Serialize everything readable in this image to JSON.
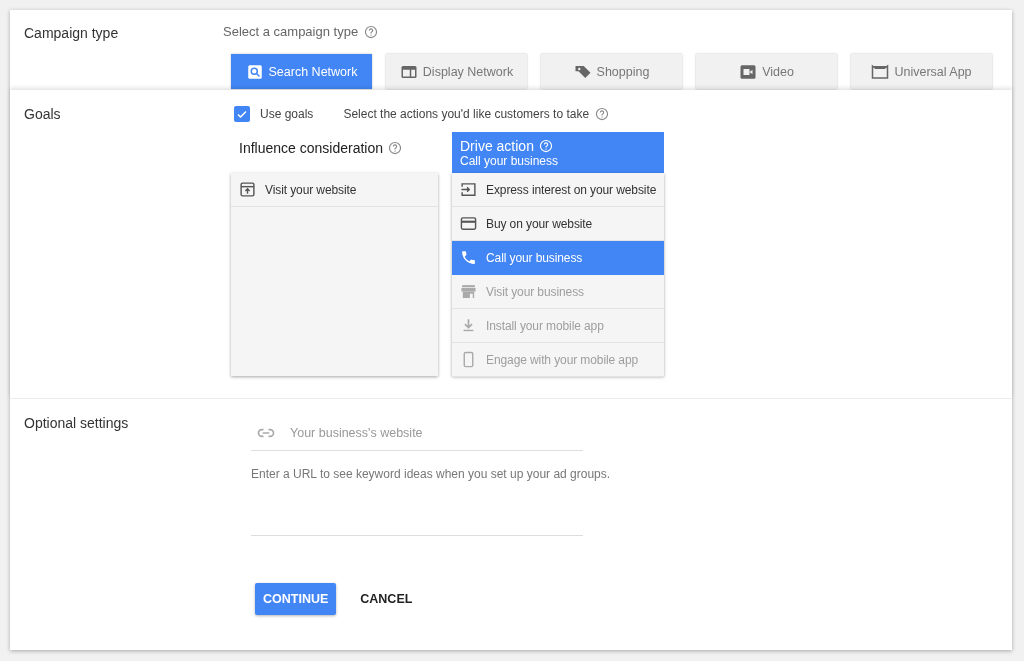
{
  "campaign_type": {
    "label": "Campaign type",
    "prompt": "Select a campaign type",
    "tabs": [
      {
        "label": "Search Network",
        "selected": true
      },
      {
        "label": "Display Network",
        "selected": false
      },
      {
        "label": "Shopping",
        "selected": false
      },
      {
        "label": "Video",
        "selected": false
      },
      {
        "label": "Universal App",
        "selected": false
      }
    ]
  },
  "goals": {
    "label": "Goals",
    "use_goals": {
      "label": "Use goals",
      "checked": true
    },
    "prompt": "Select the actions you'd like customers to take",
    "columns": [
      {
        "title": "Influence consideration",
        "selected": false,
        "options": [
          {
            "label": "Visit your website",
            "selected": false,
            "disabled": false
          }
        ]
      },
      {
        "title": "Drive action",
        "subtitle": "Call your business",
        "selected": true,
        "options": [
          {
            "label": "Express interest on your website",
            "selected": false,
            "disabled": false
          },
          {
            "label": "Buy on your website",
            "selected": false,
            "disabled": false
          },
          {
            "label": "Call your business",
            "selected": true,
            "disabled": false
          },
          {
            "label": "Visit your business",
            "selected": false,
            "disabled": true
          },
          {
            "label": "Install your mobile app",
            "selected": false,
            "disabled": true
          },
          {
            "label": "Engage with your mobile app",
            "selected": false,
            "disabled": true
          }
        ]
      }
    ]
  },
  "optional_settings": {
    "label": "Optional settings",
    "website": {
      "placeholder": "Your business's website"
    },
    "hint": "Enter a URL to see keyword ideas when you set up your ad groups."
  },
  "buttons": [
    {
      "label": "CONTINUE",
      "kind": "primary"
    },
    {
      "label": "CANCEL",
      "kind": "text"
    }
  ]
}
